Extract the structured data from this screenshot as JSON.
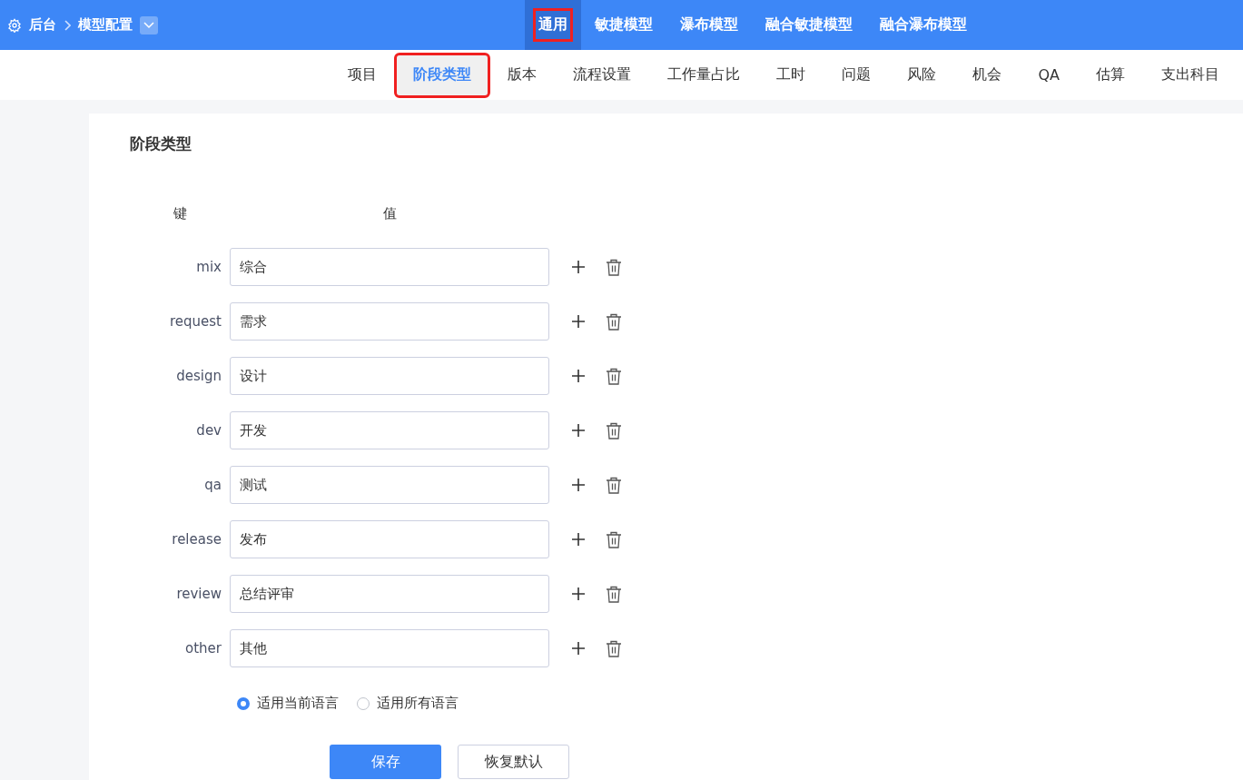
{
  "breadcrumb": {
    "root": "后台",
    "current": "模型配置"
  },
  "top_tabs": [
    {
      "label": "通用",
      "selected": true,
      "highlighted": true
    },
    {
      "label": "敏捷模型",
      "selected": false,
      "highlighted": false
    },
    {
      "label": "瀑布模型",
      "selected": false,
      "highlighted": false
    },
    {
      "label": "融合敏捷模型",
      "selected": false,
      "highlighted": false
    },
    {
      "label": "融合瀑布模型",
      "selected": false,
      "highlighted": false
    }
  ],
  "sub_tabs": [
    {
      "label": "项目",
      "selected": false,
      "highlighted": false
    },
    {
      "label": "阶段类型",
      "selected": true,
      "highlighted": true
    },
    {
      "label": "版本",
      "selected": false,
      "highlighted": false
    },
    {
      "label": "流程设置",
      "selected": false,
      "highlighted": false
    },
    {
      "label": "工作量占比",
      "selected": false,
      "highlighted": false
    },
    {
      "label": "工时",
      "selected": false,
      "highlighted": false
    },
    {
      "label": "问题",
      "selected": false,
      "highlighted": false
    },
    {
      "label": "风险",
      "selected": false,
      "highlighted": false
    },
    {
      "label": "机会",
      "selected": false,
      "highlighted": false
    },
    {
      "label": "QA",
      "selected": false,
      "highlighted": false
    },
    {
      "label": "估算",
      "selected": false,
      "highlighted": false
    },
    {
      "label": "支出科目",
      "selected": false,
      "highlighted": false
    }
  ],
  "panel": {
    "title": "阶段类型",
    "columns": [
      "键",
      "值"
    ],
    "rows": [
      {
        "key": "mix",
        "value": "综合"
      },
      {
        "key": "request",
        "value": "需求"
      },
      {
        "key": "design",
        "value": "设计"
      },
      {
        "key": "dev",
        "value": "开发"
      },
      {
        "key": "qa",
        "value": "测试"
      },
      {
        "key": "release",
        "value": "发布"
      },
      {
        "key": "review",
        "value": "总结评审"
      },
      {
        "key": "other",
        "value": "其他"
      }
    ],
    "scope": [
      {
        "label": "适用当前语言",
        "selected": true
      },
      {
        "label": "适用所有语言",
        "selected": false
      }
    ],
    "buttons": [
      {
        "label": "保存",
        "kind": "primary"
      },
      {
        "label": "恢复默认",
        "kind": "secondary"
      }
    ]
  }
}
